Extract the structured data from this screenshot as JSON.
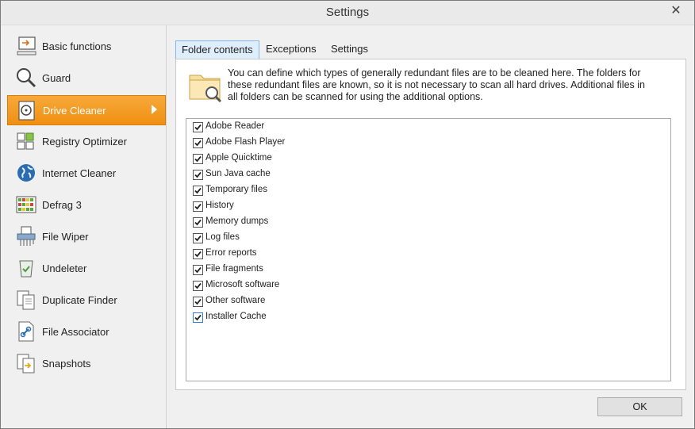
{
  "window": {
    "title": "Settings"
  },
  "sidebar": {
    "items": [
      {
        "label": "Basic functions",
        "icon": "basic-functions-icon"
      },
      {
        "label": "Guard",
        "icon": "guard-magnifier-icon"
      },
      {
        "label": "Drive Cleaner",
        "icon": "drive-cleaner-icon",
        "active": true
      },
      {
        "label": "Registry Optimizer",
        "icon": "registry-optimizer-icon"
      },
      {
        "label": "Internet Cleaner",
        "icon": "globe-icon"
      },
      {
        "label": "Defrag 3",
        "icon": "defrag-icon"
      },
      {
        "label": "File Wiper",
        "icon": "shredder-icon"
      },
      {
        "label": "Undeleter",
        "icon": "recycle-bin-icon"
      },
      {
        "label": "Duplicate Finder",
        "icon": "duplicate-files-icon"
      },
      {
        "label": "File Associator",
        "icon": "file-link-icon"
      },
      {
        "label": "Snapshots",
        "icon": "snapshots-icon"
      }
    ]
  },
  "tabs": [
    {
      "label": "Folder contents",
      "active": true
    },
    {
      "label": "Exceptions",
      "active": false
    },
    {
      "label": "Settings",
      "active": false
    }
  ],
  "panel": {
    "description": "You can define which types of generally redundant files are to be cleaned here. The folders for these redundant files are known, so it is not necessary to scan all hard drives. Additional files in all folders can be scanned for using the additional options.",
    "items": [
      {
        "label": "Adobe Reader",
        "checked": true
      },
      {
        "label": "Adobe Flash Player",
        "checked": true
      },
      {
        "label": "Apple Quicktime",
        "checked": true
      },
      {
        "label": "Sun Java cache",
        "checked": true
      },
      {
        "label": "Temporary files",
        "checked": true
      },
      {
        "label": "History",
        "checked": true
      },
      {
        "label": "Memory dumps",
        "checked": true
      },
      {
        "label": "Log files",
        "checked": true
      },
      {
        "label": "Error reports",
        "checked": true
      },
      {
        "label": "File fragments",
        "checked": true
      },
      {
        "label": "Microsoft software",
        "checked": true
      },
      {
        "label": "Other software",
        "checked": true
      },
      {
        "label": "Installer Cache",
        "checked": true
      }
    ]
  },
  "footer": {
    "ok_label": "OK"
  },
  "colors": {
    "accent": "#f39a1f",
    "tab_active_bg": "#dfeefc",
    "tab_active_border": "#86b6e6"
  }
}
